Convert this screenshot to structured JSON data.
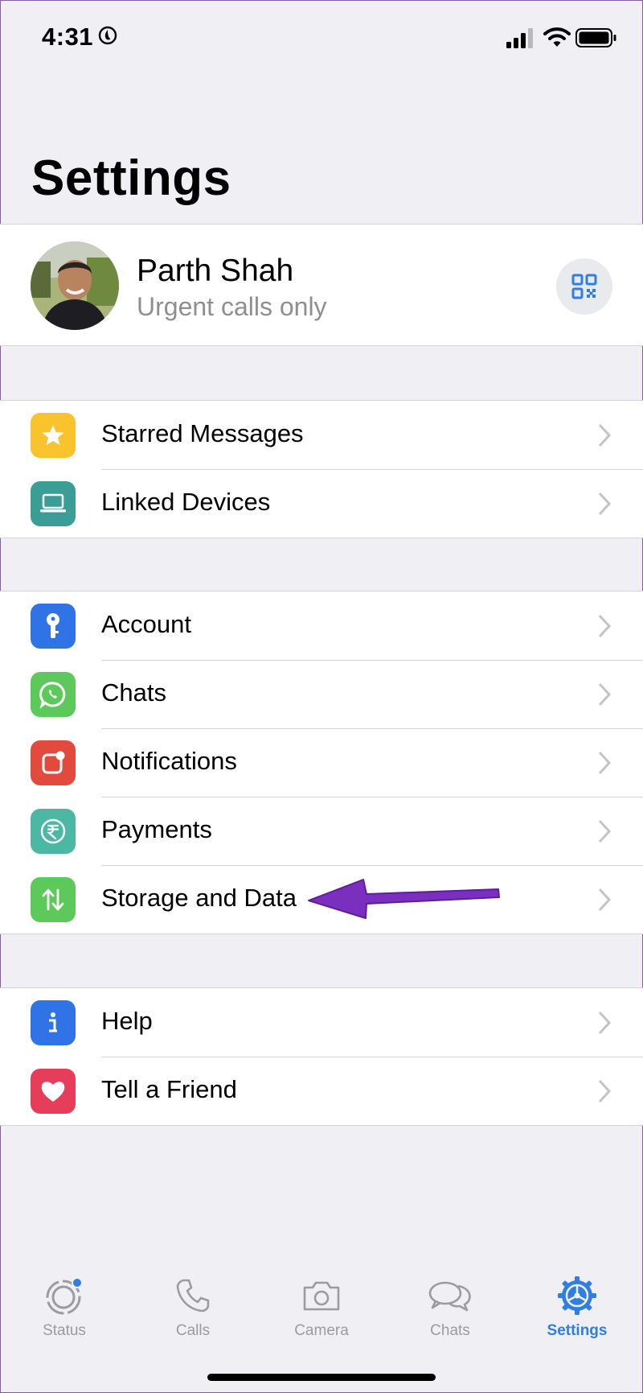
{
  "status_bar": {
    "time": "4:31"
  },
  "page_title": "Settings",
  "profile": {
    "name": "Parth Shah",
    "status": "Urgent calls only"
  },
  "groups": [
    {
      "items": [
        {
          "label": "Starred Messages",
          "icon": "star-icon",
          "color": "#f8c32c"
        },
        {
          "label": "Linked Devices",
          "icon": "laptop-icon",
          "color": "#3a9e96"
        }
      ]
    },
    {
      "items": [
        {
          "label": "Account",
          "icon": "key-icon",
          "color": "#2f73e6"
        },
        {
          "label": "Chats",
          "icon": "whatsapp-icon",
          "color": "#5cc95a"
        },
        {
          "label": "Notifications",
          "icon": "notification-icon",
          "color": "#e34a3e"
        },
        {
          "label": "Payments",
          "icon": "rupee-icon",
          "color": "#4cb8a3"
        },
        {
          "label": "Storage and Data",
          "icon": "arrows-updown-icon",
          "color": "#5cc95a"
        }
      ]
    },
    {
      "items": [
        {
          "label": "Help",
          "icon": "info-icon",
          "color": "#2f73e6"
        },
        {
          "label": "Tell a Friend",
          "icon": "heart-icon",
          "color": "#e63e5a"
        }
      ]
    }
  ],
  "tabs": [
    {
      "label": "Status",
      "icon": "status-icon"
    },
    {
      "label": "Calls",
      "icon": "phone-icon"
    },
    {
      "label": "Camera",
      "icon": "camera-icon"
    },
    {
      "label": "Chats",
      "icon": "chat-bubbles-icon"
    },
    {
      "label": "Settings",
      "icon": "settings-gear-icon",
      "active": true
    }
  ],
  "colors": {
    "accent": "#2f7ee0",
    "annotation_arrow": "#7b2fbe"
  }
}
